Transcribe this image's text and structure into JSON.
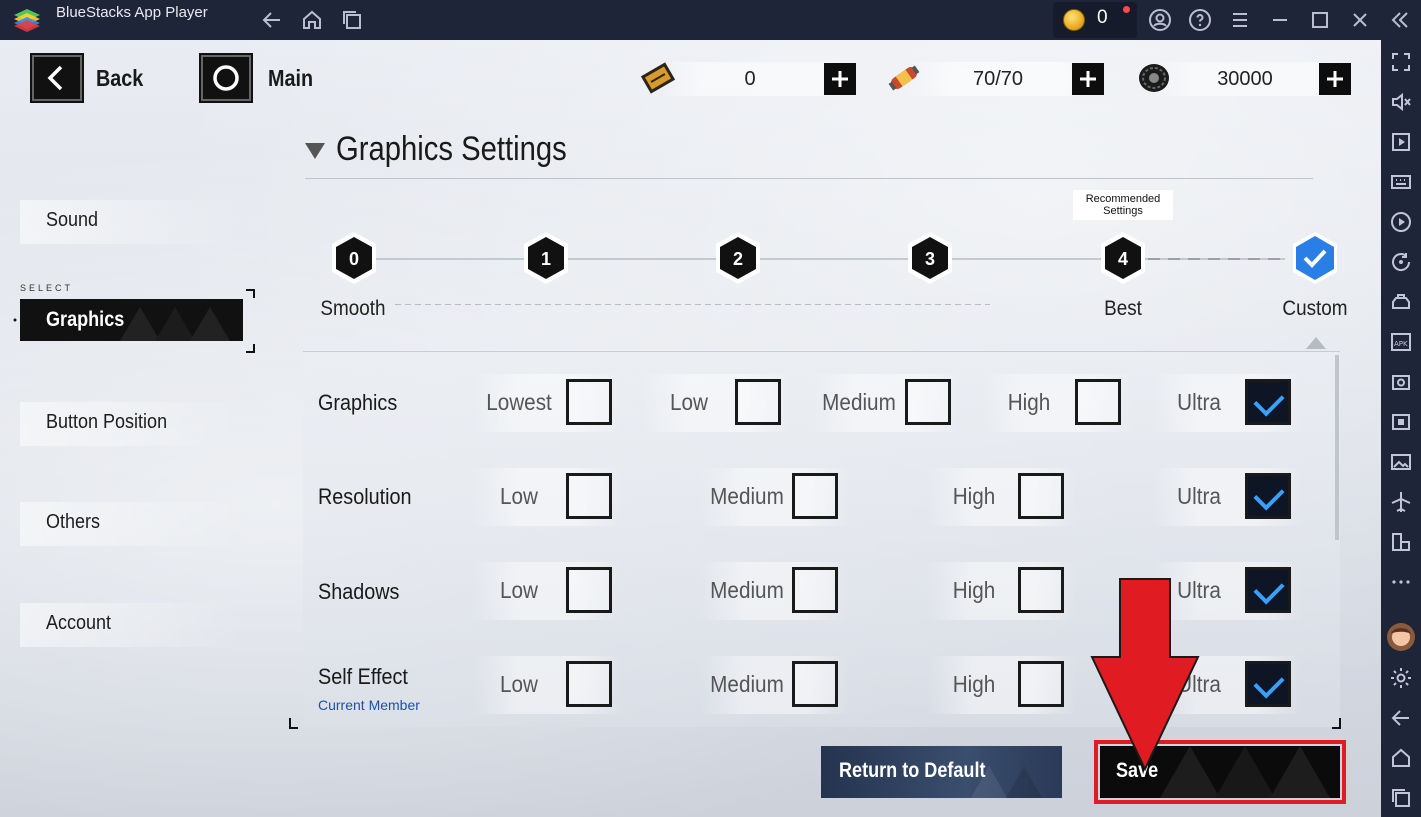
{
  "window": {
    "title": "BlueStacks App Player",
    "coins": "0"
  },
  "top_bar": {
    "back_label": "Back",
    "main_label": "Main",
    "resources": [
      {
        "icon": "ticket-icon",
        "value": "0"
      },
      {
        "icon": "energy-capsule-icon",
        "value": "70/70"
      },
      {
        "icon": "tire-icon",
        "value": "30000"
      }
    ]
  },
  "menu": {
    "select_tag": "SELECT",
    "items": [
      "Sound",
      "Graphics",
      "Button Position",
      "Others",
      "Account"
    ],
    "selected": "Graphics"
  },
  "section": {
    "title": "Graphics Settings"
  },
  "presets": {
    "numbers": [
      "0",
      "1",
      "2",
      "3",
      "4"
    ],
    "labels": {
      "smooth": "Smooth",
      "best": "Best",
      "custom": "Custom"
    },
    "recommended_line1": "Recommended",
    "recommended_line2": "Settings",
    "selected": "Custom"
  },
  "settings": {
    "graphics": {
      "label": "Graphics",
      "options": [
        "Lowest",
        "Low",
        "Medium",
        "High",
        "Ultra"
      ],
      "selected": "Ultra"
    },
    "resolution": {
      "label": "Resolution",
      "options": [
        "Low",
        "Medium",
        "High",
        "Ultra"
      ],
      "selected": "Ultra"
    },
    "shadows": {
      "label": "Shadows",
      "options": [
        "Low",
        "Medium",
        "High",
        "Ultra"
      ],
      "selected": "Ultra"
    },
    "self_effect": {
      "label": "Self Effect",
      "sublabel": "Current Member",
      "options": [
        "Low",
        "Medium",
        "High",
        "Ultra"
      ],
      "selected": "Ultra"
    }
  },
  "buttons": {
    "return_default": "Return to Default",
    "save": "Save"
  },
  "colors": {
    "highlight_red": "#e11b22",
    "check_blue": "#3aa0ff",
    "custom_hex_blue": "#2a7fe6"
  }
}
